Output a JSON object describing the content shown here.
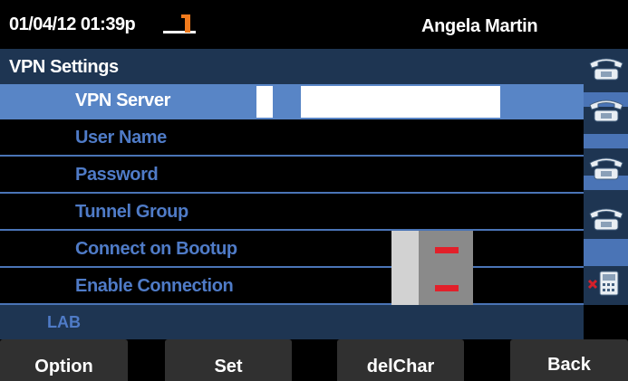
{
  "status": {
    "datetime": "01/04/12 01:39p",
    "user": "Angela Martin"
  },
  "screen": {
    "title": "VPN Settings",
    "rows": [
      {
        "label": "VPN Server"
      },
      {
        "label": "User Name"
      },
      {
        "label": "Password"
      },
      {
        "label": "Tunnel Group"
      },
      {
        "label": "Connect on Bootup",
        "toggle": "off"
      },
      {
        "label": "Enable Connection",
        "toggle": "off"
      }
    ],
    "info": "LAB"
  },
  "softkeys": [
    "Option",
    "Set",
    "delChar",
    "Back"
  ],
  "colors": {
    "accent": "#5885c6",
    "panel": "#1e3552",
    "label": "#4f7bc7",
    "toggle_off": "#e2202a"
  },
  "icons": [
    "offhook-handset-icon",
    "phone-line-icon",
    "phone-line-icon",
    "phone-line-icon",
    "phone-line-icon",
    "phone-unregistered-icon"
  ]
}
